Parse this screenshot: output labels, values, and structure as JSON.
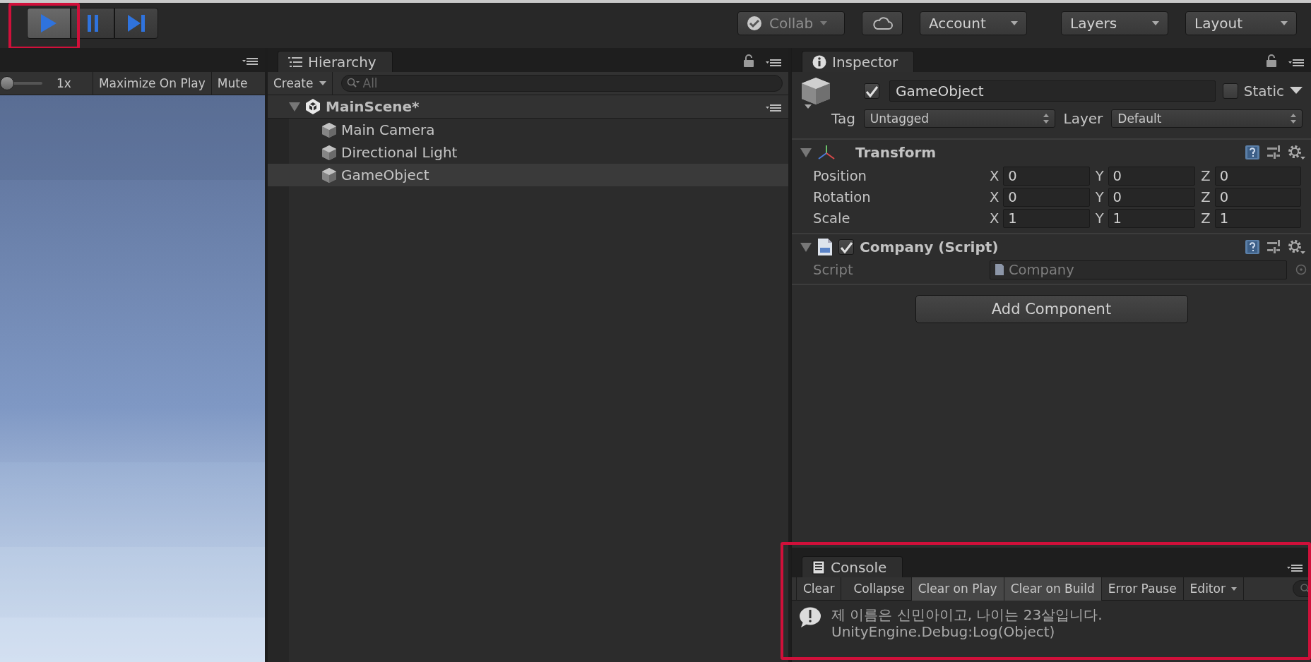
{
  "toolbar": {
    "play_controls": [
      {
        "kind": "play",
        "on": true,
        "highlighted": true
      },
      {
        "kind": "pause",
        "on": false,
        "highlighted": false
      },
      {
        "kind": "step",
        "on": false,
        "highlighted": false
      }
    ],
    "collab": {
      "label": "Collab"
    },
    "menus": [
      {
        "kind": "cloud"
      },
      {
        "kind": "dropdown",
        "label": "Account"
      },
      {
        "kind": "dropdown",
        "label": "Layers"
      },
      {
        "kind": "dropdown",
        "label": "Layout"
      }
    ]
  },
  "game_view": {
    "scale": {
      "level": 0
    },
    "scale_label": "1x",
    "toggles": [
      {
        "label": "Maximize On Play",
        "on": false
      },
      {
        "label": "Mute",
        "on": false
      }
    ]
  },
  "hierarchy": {
    "tab": "Hierarchy",
    "create": "Create",
    "search": {
      "placeholder": "All"
    },
    "scene": {
      "name": "MainScene*",
      "expanded": true,
      "children": [
        {
          "name": "Main Camera",
          "selected": false
        },
        {
          "name": "Directional Light",
          "selected": false
        },
        {
          "name": "GameObject",
          "selected": true
        }
      ]
    }
  },
  "inspector": {
    "tab": "Inspector",
    "object": {
      "active": true,
      "name": "GameObject",
      "static": false,
      "static_label": "Static",
      "tag_label": "Tag",
      "tag": "Untagged",
      "layer_label": "Layer",
      "layer": "Default"
    },
    "components": [
      {
        "kind": "transform",
        "title": "Transform",
        "expanded": true,
        "rows": [
          {
            "label": "Position",
            "fields": [
              {
                "axis": "X",
                "value": "0"
              },
              {
                "axis": "Y",
                "value": "0"
              },
              {
                "axis": "Z",
                "value": "0"
              }
            ]
          },
          {
            "label": "Rotation",
            "fields": [
              {
                "axis": "X",
                "value": "0"
              },
              {
                "axis": "Y",
                "value": "0"
              },
              {
                "axis": "Z",
                "value": "0"
              }
            ]
          },
          {
            "label": "Scale",
            "fields": [
              {
                "axis": "X",
                "value": "1"
              },
              {
                "axis": "Y",
                "value": "1"
              },
              {
                "axis": "Z",
                "value": "1"
              }
            ]
          }
        ]
      },
      {
        "kind": "script",
        "title": "Company (Script)",
        "expanded": true,
        "enabled": true,
        "script_label": "Script",
        "script": "Company"
      }
    ],
    "add_button": "Add Component"
  },
  "console": {
    "tab": "Console",
    "highlighted": true,
    "tools": [
      {
        "kind": "button",
        "label": "Clear"
      },
      {
        "kind": "toggle",
        "label": "Collapse",
        "on": false
      },
      {
        "kind": "toggle",
        "label": "Clear on Play",
        "on": true
      },
      {
        "kind": "toggle",
        "label": "Clear on Build",
        "on": true
      },
      {
        "kind": "toggle",
        "label": "Error Pause",
        "on": false
      },
      {
        "kind": "dropdown",
        "label": "Editor"
      }
    ],
    "messages": [
      {
        "kind": "log",
        "text": "제 이름은 신민아이고, 나이는 23살입니다.",
        "stack": "UnityEngine.Debug:Log(Object)"
      }
    ]
  }
}
